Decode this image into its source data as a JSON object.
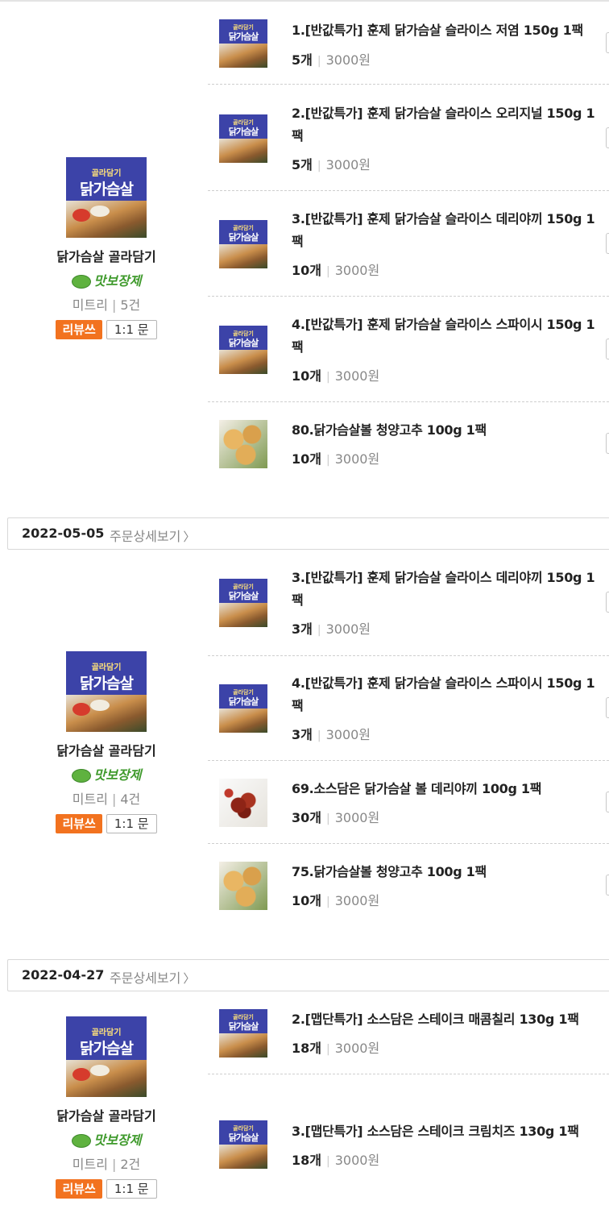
{
  "orders": [
    {
      "date": "",
      "detail_label": "",
      "seller": {
        "thumb_top": "골라담기",
        "thumb_title": "닭가슴살",
        "name": "닭가슴살 골라담기",
        "badge": "맛보장제",
        "brand": "미트리",
        "count": "5건",
        "review_label": "리뷰쓰",
        "chat_label": "1:1 문"
      },
      "items": [
        {
          "title": "1.[반값특가] 훈제 닭가슴살 슬라이스 저염 150g 1팩",
          "qty": "5개",
          "price": "3000원",
          "thumb": "chicken-slice-thumb"
        },
        {
          "title": "2.[반값특가] 훈제 닭가슴살 슬라이스 오리지널 150g 1팩",
          "qty": "5개",
          "price": "3000원",
          "thumb": "chicken-slice-thumb"
        },
        {
          "title": "3.[반값특가] 훈제 닭가슴살 슬라이스 데리야끼 150g 1팩",
          "qty": "10개",
          "price": "3000원",
          "thumb": "chicken-slice-thumb"
        },
        {
          "title": "4.[반값특가] 훈제 닭가슴살 슬라이스 스파이시 150g 1팩",
          "qty": "10개",
          "price": "3000원",
          "thumb": "chicken-slice-thumb"
        },
        {
          "title": "80.닭가슴살볼 청양고추 100g 1팩",
          "qty": "10개",
          "price": "3000원",
          "thumb": "chicken-ball-thumb"
        }
      ]
    },
    {
      "date": "2022-05-05",
      "detail_label": "주문상세보기",
      "seller": {
        "thumb_top": "골라담기",
        "thumb_title": "닭가슴살",
        "name": "닭가슴살 골라담기",
        "badge": "맛보장제",
        "brand": "미트리",
        "count": "4건",
        "review_label": "리뷰쓰",
        "chat_label": "1:1 문"
      },
      "items": [
        {
          "title": "3.[반값특가] 훈제 닭가슴살 슬라이스 데리야끼 150g 1팩",
          "qty": "3개",
          "price": "3000원",
          "thumb": "chicken-slice-thumb"
        },
        {
          "title": "4.[반값특가] 훈제 닭가슴살 슬라이스 스파이시 150g 1팩",
          "qty": "3개",
          "price": "3000원",
          "thumb": "chicken-slice-thumb"
        },
        {
          "title": "69.소스담은 닭가슴살 볼 데리야끼 100g 1팩",
          "qty": "30개",
          "price": "3000원",
          "thumb": "sauce-ball-thumb"
        },
        {
          "title": "75.닭가슴살볼 청양고추 100g 1팩",
          "qty": "10개",
          "price": "3000원",
          "thumb": "chicken-ball-thumb"
        }
      ]
    },
    {
      "date": "2022-04-27",
      "detail_label": "주문상세보기",
      "seller": {
        "thumb_top": "골라담기",
        "thumb_title": "닭가슴살",
        "name": "닭가슴살 골라담기",
        "badge": "맛보장제",
        "brand": "미트리",
        "count": "2건",
        "review_label": "리뷰쓰",
        "chat_label": "1:1 문"
      },
      "items": [
        {
          "title": "2.[맵단특가] 소스담은 스테이크 매콤칠리 130g 1팩",
          "qty": "18개",
          "price": "3000원",
          "thumb": "chicken-slice-thumb"
        },
        {
          "title": "3.[맵단특가] 소스담은 스테이크 크림치즈 130g 1팩",
          "qty": "18개",
          "price": "3000원",
          "thumb": "chicken-slice-thumb"
        }
      ]
    }
  ]
}
